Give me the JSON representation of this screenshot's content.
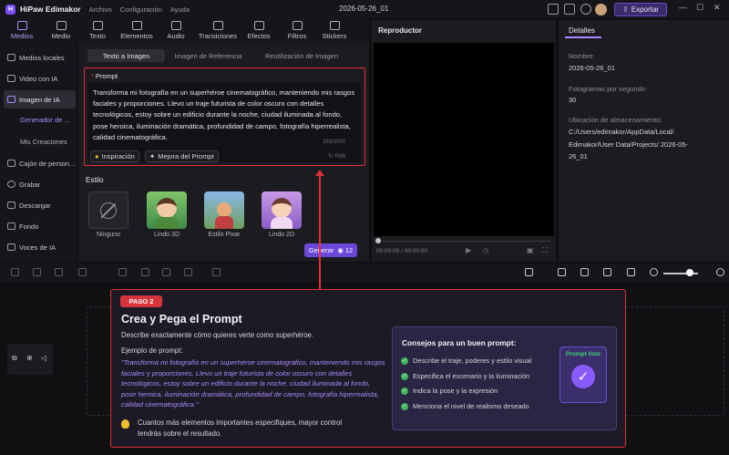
{
  "app": {
    "name": "HiPaw Edimakor",
    "menus": [
      "Archivo",
      "Configuración",
      "Ayuda"
    ],
    "project_title": "2026-05-26_01",
    "export_label": "Exportar"
  },
  "toolbar": {
    "items": [
      {
        "label": "Medios",
        "active": true,
        "icon": "media-icon"
      },
      {
        "label": "Medio",
        "active": false,
        "icon": "audio-medio-icon"
      },
      {
        "label": "Texto",
        "active": false,
        "icon": "text-icon"
      },
      {
        "label": "Elementos",
        "active": false,
        "icon": "elements-icon"
      },
      {
        "label": "Audio",
        "active": false,
        "icon": "audio-icon"
      },
      {
        "label": "Transiciones",
        "active": false,
        "icon": "transitions-icon"
      },
      {
        "label": "Efectos",
        "active": false,
        "icon": "effects-icon"
      },
      {
        "label": "Filtros",
        "active": false,
        "icon": "filters-icon"
      },
      {
        "label": "Stickers",
        "active": false,
        "icon": "stickers-icon"
      }
    ]
  },
  "sidebar": {
    "items": [
      {
        "label": "Medios locales",
        "icon": "folder-icon"
      },
      {
        "label": "Video con IA",
        "icon": "video-ai-icon"
      },
      {
        "label": "Imagen de IA",
        "icon": "image-ai-icon",
        "active": true
      },
      {
        "label": "Cajón de person...",
        "icon": "box-icon"
      },
      {
        "label": "Grabar",
        "icon": "record-icon"
      },
      {
        "label": "Descargar",
        "icon": "download-icon"
      },
      {
        "label": "Fondo",
        "icon": "background-icon"
      },
      {
        "label": "Voces de IA",
        "icon": "voice-icon"
      }
    ],
    "subitems": [
      {
        "label": "Generador de ...",
        "active": true
      },
      {
        "label": "Mis Creaciones",
        "active": false
      }
    ]
  },
  "panel": {
    "tabs": [
      {
        "label": "Texto a Imagen",
        "active": true
      },
      {
        "label": "Imagen de Referencia",
        "active": false
      },
      {
        "label": "Reutilización de Imagen",
        "active": false
      }
    ],
    "prompt_label": "Prompt",
    "prompt_text": "Transforma mi fotografía en un superhéroe cinematográfico, manteniendo mis rasgos faciales y proporciones. Llevo un traje futurista de color oscuro con detalles tecnológicos, estoy sobre un edificio durante la noche, ciudad iluminada al fondo, pose heroica, iluminación dramática, profundidad de campo, fotografía hiperrealista, calidad cinematográfica.",
    "prompt_count": "383/1000",
    "inspiracion_label": "Inspiración",
    "mejora_label": "Mejora del Prompt",
    "dice_value": "R86",
    "style_label": "Estilo",
    "styles": [
      {
        "label": "Ninguno"
      },
      {
        "label": "Lindo 3D"
      },
      {
        "label": "Estilo Pixar"
      },
      {
        "label": "Lindo 2D"
      }
    ],
    "generar_label": "Generar",
    "generar_cost": "12"
  },
  "player": {
    "title": "Reproductor",
    "time": "00:00:00 / 00:00:00"
  },
  "details": {
    "tab": "Detalles",
    "name_label": "Nombre:",
    "name_value": "2026-05-26_01",
    "fps_label": "Fotogramas por segundo:",
    "fps_value": "30",
    "location_label": "Ubicación de almacenamiento:",
    "location_value": "C:/Users/edimakor/AppData/Local/ Edimakor/User Data/Projects/ 2026-05-26_01"
  },
  "tutorial": {
    "step": "PASO 2",
    "title": "Crea y Pega el Prompt",
    "description": "Describe exactamente cómo quieres verte como superhéroe.",
    "example_label": "Ejemplo de prompt:",
    "example_text": "\"Transforma mi fotografía en un superhéroe cinematográfico, manteniendo mis rasgos faciales y proporciones. Llevo un traje futurista de color oscuro con detalles tecnológicos, estoy sobre un edificio durante la noche, ciudad iluminada al fondo, pose heroica, iluminación dramática, profundidad de campo, fotografía hiperrealista, calidad cinematográfica.\"",
    "tip": "Cuantos más elementos importantes especifiques, mayor control tendrás sobre el resultado.",
    "consejos_title": "Consejos para un buen prompt:",
    "consejos": [
      "Describe el traje, poderes y estilo visual",
      "Especifica el escenario y la iluminación",
      "Indica la pose y la expresión",
      "Menciona el nivel de realismo deseado"
    ],
    "prompt_listo": "Prompt listo"
  },
  "colors": {
    "accent": "#7b4dff",
    "highlight": "#e0323a",
    "check": "#3cb55a"
  }
}
